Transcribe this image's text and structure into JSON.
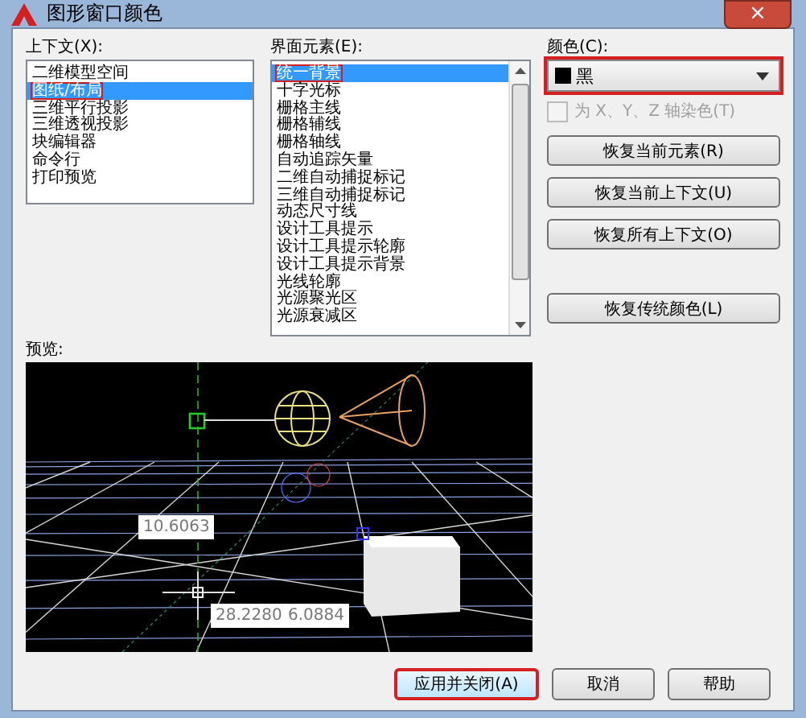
{
  "window": {
    "title": "图形窗口颜色",
    "close": "×"
  },
  "context": {
    "label": "上下文(X):",
    "items": [
      {
        "label": "二维模型空间",
        "selected": false,
        "callout": false
      },
      {
        "label": "图纸/布局",
        "selected": true,
        "callout": true
      },
      {
        "label": "三维平行投影",
        "selected": false,
        "callout": false
      },
      {
        "label": "三维透视投影",
        "selected": false,
        "callout": false
      },
      {
        "label": "块编辑器",
        "selected": false,
        "callout": false
      },
      {
        "label": "命令行",
        "selected": false,
        "callout": false
      },
      {
        "label": "打印预览",
        "selected": false,
        "callout": false
      }
    ]
  },
  "elements": {
    "label": "界面元素(E):",
    "items": [
      {
        "label": "统一背景",
        "selected": true,
        "callout": true
      },
      {
        "label": "十字光标",
        "selected": false,
        "callout": false
      },
      {
        "label": "栅格主线",
        "selected": false,
        "callout": false
      },
      {
        "label": "栅格辅线",
        "selected": false,
        "callout": false
      },
      {
        "label": "栅格轴线",
        "selected": false,
        "callout": false
      },
      {
        "label": "自动追踪矢量",
        "selected": false,
        "callout": false
      },
      {
        "label": "二维自动捕捉标记",
        "selected": false,
        "callout": false
      },
      {
        "label": "三维自动捕捉标记",
        "selected": false,
        "callout": false
      },
      {
        "label": "动态尺寸线",
        "selected": false,
        "callout": false
      },
      {
        "label": "设计工具提示",
        "selected": false,
        "callout": false
      },
      {
        "label": "设计工具提示轮廓",
        "selected": false,
        "callout": false
      },
      {
        "label": "设计工具提示背景",
        "selected": false,
        "callout": false
      },
      {
        "label": "光线轮廓",
        "selected": false,
        "callout": false
      },
      {
        "label": "光源聚光区",
        "selected": false,
        "callout": false
      },
      {
        "label": "光源衰减区",
        "selected": false,
        "callout": false
      }
    ]
  },
  "color": {
    "label": "颜色(C):",
    "value": "黑",
    "callout": true
  },
  "axis_tint": {
    "label": "为 X、Y、Z 轴染色(T)",
    "checked": false,
    "disabled": true
  },
  "restore_buttons": [
    "恢复当前元素(R)",
    "恢复当前上下文(U)",
    "恢复所有上下文(O)",
    "恢复传统颜色(L)"
  ],
  "preview": {
    "label": "预览:",
    "tooltips": [
      "10.6063",
      "28.2280",
      "6.0884"
    ]
  },
  "buttons": [
    {
      "label": "应用并关闭(A)",
      "callout": true
    },
    {
      "label": "取消",
      "callout": false
    },
    {
      "label": "帮助",
      "callout": false
    }
  ]
}
